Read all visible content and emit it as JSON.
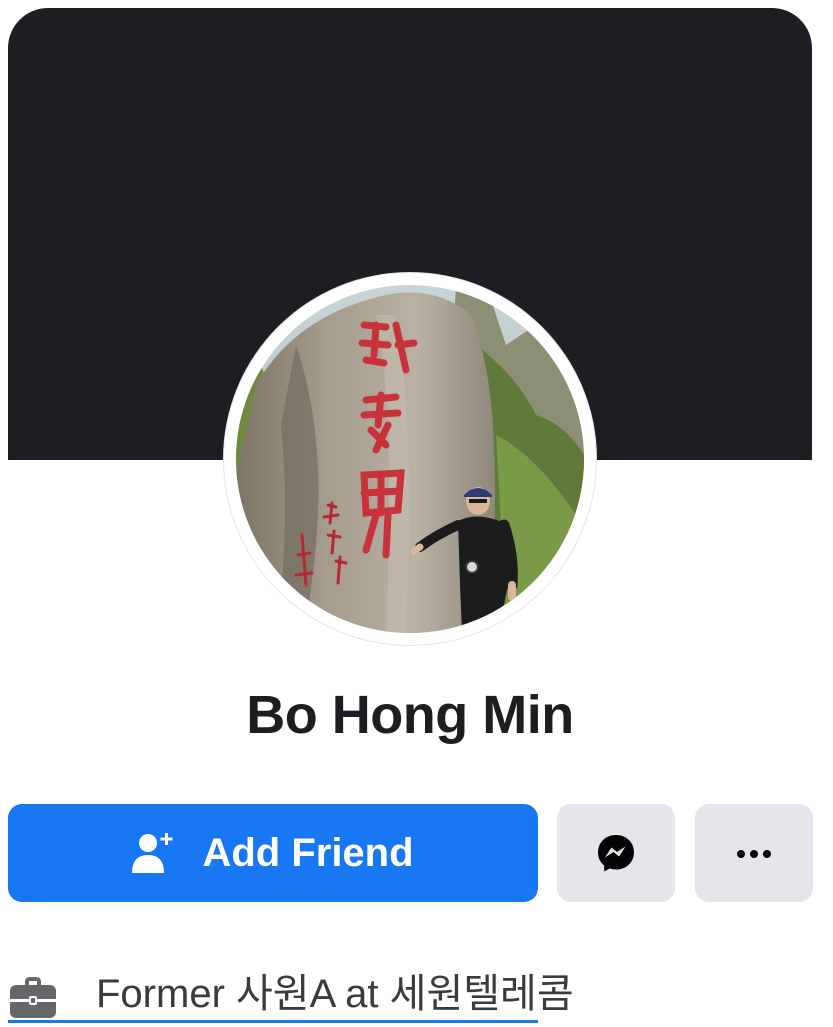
{
  "profile": {
    "name": "Bo Hong Min",
    "avatar_alt": "profile-photo",
    "cover_color": "#1d1e22"
  },
  "actions": {
    "add_friend_label": "Add Friend",
    "add_friend_icon": "person-add-icon",
    "message_icon": "messenger-icon",
    "more_icon": "more-dots-icon"
  },
  "intro": {
    "work_icon": "briefcase-icon",
    "work_text": "Former 사원A at 세원텔레콤"
  },
  "colors": {
    "accent": "#1877f2",
    "secondary_button": "#e4e6eb",
    "text": "#1c1e21"
  }
}
